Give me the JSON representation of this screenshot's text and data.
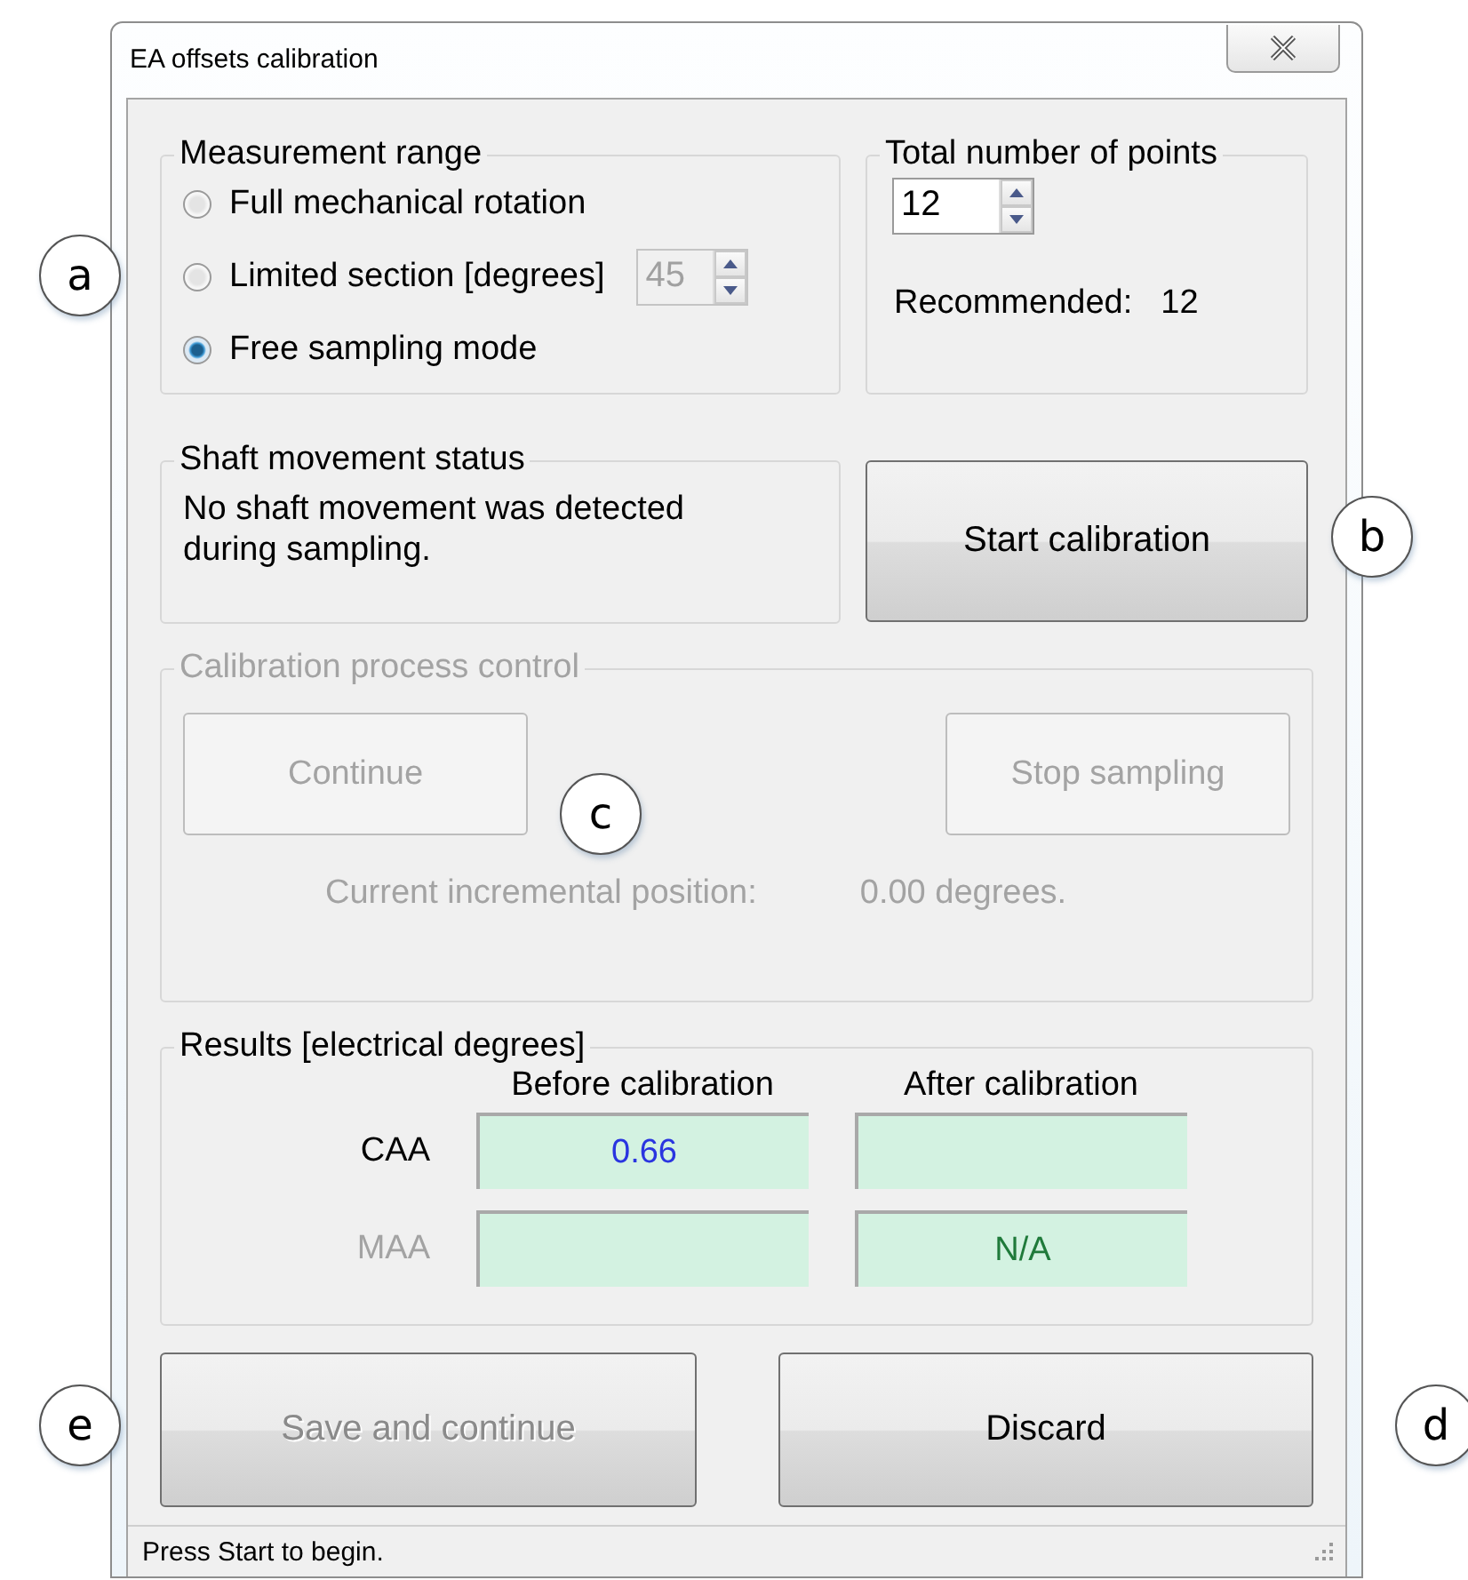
{
  "window": {
    "title": "EA offsets calibration"
  },
  "measurement_range": {
    "title": "Measurement range",
    "options": [
      {
        "label": "Full mechanical rotation",
        "selected": false
      },
      {
        "label": "Limited section [degrees]",
        "selected": false,
        "spin_value": "45",
        "spin_disabled": true
      },
      {
        "label": "Free sampling mode",
        "selected": true
      }
    ]
  },
  "points": {
    "title": "Total number of points",
    "value": "12",
    "recommended_label": "Recommended:",
    "recommended_value": "12"
  },
  "shaft_status": {
    "title": "Shaft movement status",
    "message": "No shaft movement was detected during sampling."
  },
  "start_button": {
    "label": "Start calibration",
    "disabled": false
  },
  "process_control": {
    "title": "Calibration process control",
    "disabled": true,
    "buttons": [
      {
        "label": "Continue"
      },
      {
        "label": "Stop sampling"
      }
    ],
    "position_label": "Current incremental position:",
    "position_value": "0.00 degrees."
  },
  "results": {
    "title": "Results [electrical degrees]",
    "columns": [
      "Before calibration",
      "After calibration"
    ],
    "rows": [
      {
        "label": "CAA",
        "disabled": false,
        "cells": [
          {
            "value": "0.66",
            "color": "#2a35e0"
          },
          {}
        ]
      },
      {
        "label": "MAA",
        "disabled": true,
        "cells": [
          {},
          {
            "value": "N/A",
            "color": "#1f7a3a"
          }
        ]
      }
    ]
  },
  "buttons": [
    {
      "label": "Save and continue",
      "disabled": true
    },
    {
      "label": "Discard",
      "disabled": false
    }
  ],
  "status_bar": {
    "text": "Press Start to begin."
  },
  "callouts": [
    {
      "label": "a"
    },
    {
      "label": "b"
    },
    {
      "label": "c"
    },
    {
      "label": "e"
    },
    {
      "label": "d"
    }
  ]
}
